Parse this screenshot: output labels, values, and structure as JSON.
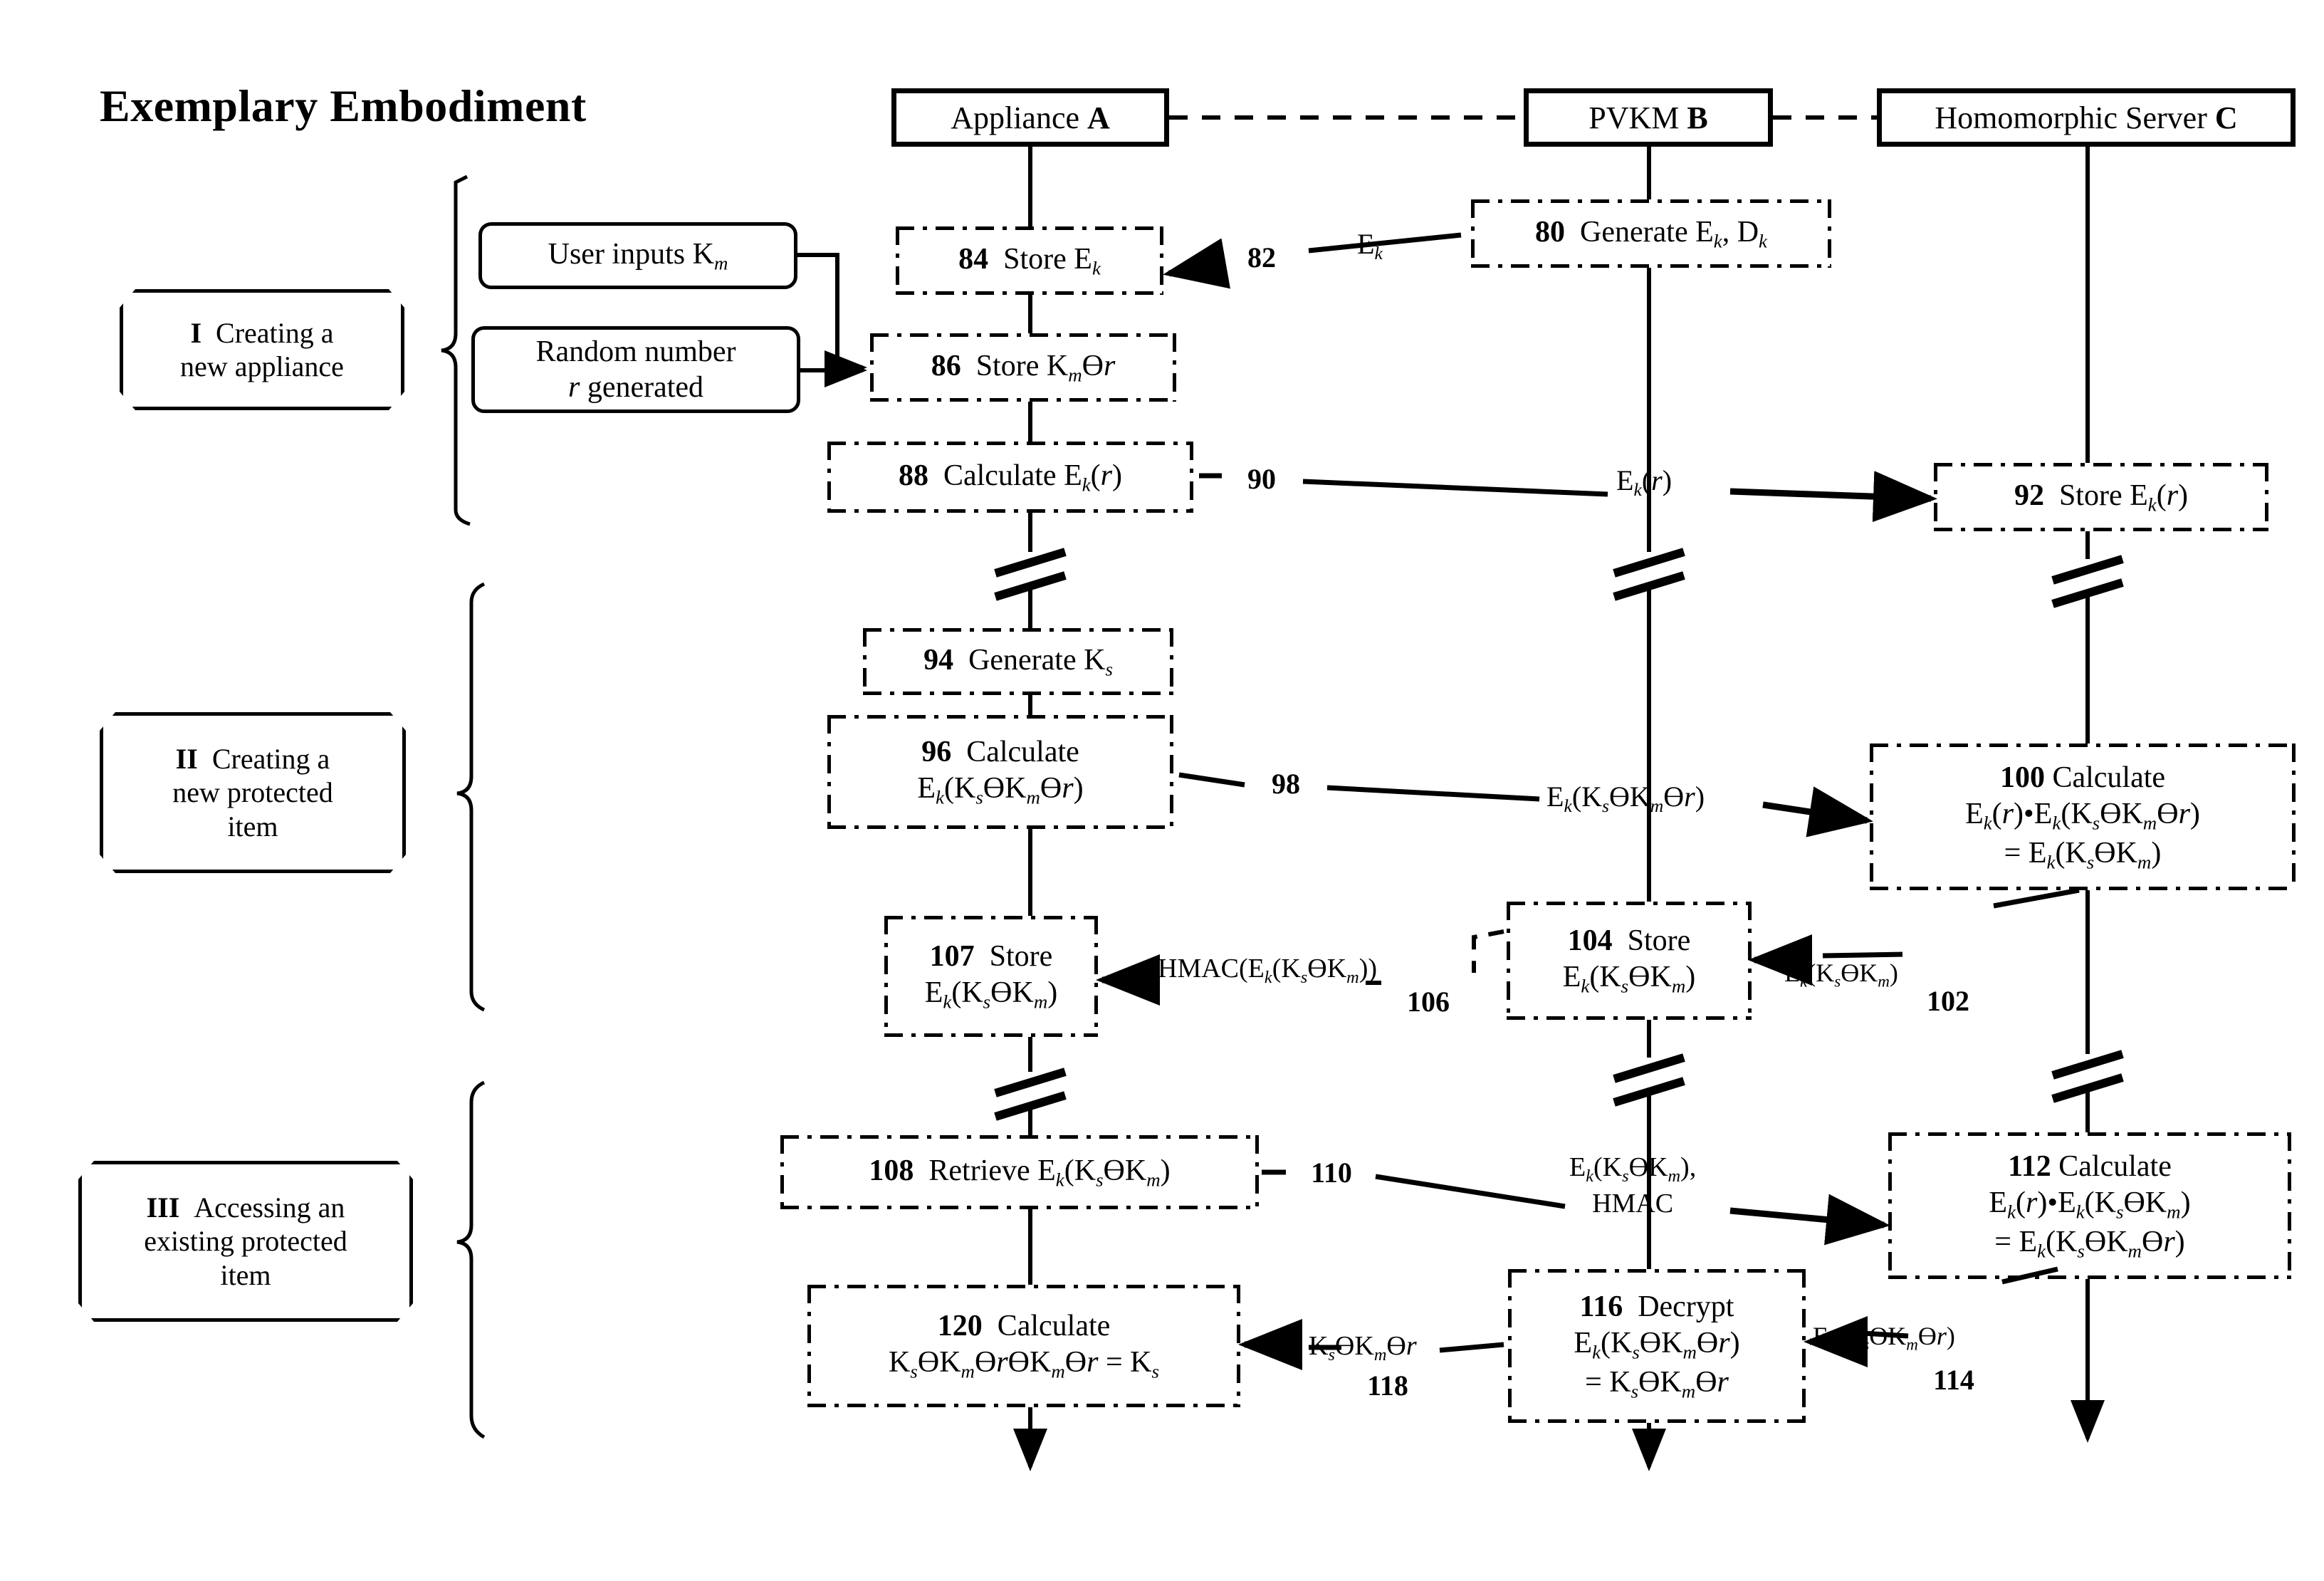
{
  "title": "Exemplary Embodiment",
  "parties": [
    {
      "id": "A",
      "name": "Appliance",
      "letter": "A"
    },
    {
      "id": "B",
      "name": "PVKM",
      "letter": "B"
    },
    {
      "id": "C",
      "name": "Homomorphic Server",
      "letter": "C"
    }
  ],
  "phases": [
    {
      "numeral": "I",
      "label": "Creating a new appliance"
    },
    {
      "numeral": "II",
      "label": "Creating a new protected item"
    },
    {
      "numeral": "III",
      "label": "Accessing an existing protected item"
    }
  ],
  "inputs": [
    {
      "id": "user-inputs",
      "text": "User inputs K_m"
    },
    {
      "id": "random-number",
      "text": "Random number r generated"
    }
  ],
  "steps": [
    {
      "num": "80",
      "column": "B",
      "text": "Generate E_k, D_k"
    },
    {
      "num": "84",
      "column": "A",
      "text": "Store E_k"
    },
    {
      "num": "86",
      "column": "A",
      "text": "Store K_mΘr"
    },
    {
      "num": "88",
      "column": "A",
      "text": "Calculate E_k(r)"
    },
    {
      "num": "92",
      "column": "C",
      "text": "Store E_k(r)"
    },
    {
      "num": "94",
      "column": "A",
      "text": "Generate K_s"
    },
    {
      "num": "96",
      "column": "A",
      "text": "Calculate E_k(K_sΘK_mΘr)"
    },
    {
      "num": "100",
      "column": "C",
      "text": "Calculate E_k(r)•E_k(K_sΘK_mΘr) = E_k(K_sΘK_m)"
    },
    {
      "num": "104",
      "column": "B",
      "text": "Store E_k(K_sΘK_m)"
    },
    {
      "num": "107",
      "column": "A",
      "text": "Store E_k(K_sΘK_m)"
    },
    {
      "num": "108",
      "column": "A",
      "text": "Retrieve E_k(K_sΘK_m)"
    },
    {
      "num": "112",
      "column": "C",
      "text": "Calculate E_k(r)•E_k(K_sΘK_m) = E_k(K_sΘK_mΘr)"
    },
    {
      "num": "116",
      "column": "B",
      "text": "Decrypt E_k(K_sΘK_mΘr) = K_sΘK_mΘr"
    },
    {
      "num": "120",
      "column": "A",
      "text": "Calculate K_sΘK_mΘrΘK_mΘr = K_s"
    }
  ],
  "tags": [
    "82",
    "90",
    "98",
    "102",
    "106",
    "110",
    "114",
    "118"
  ],
  "messages": [
    {
      "tag": "82",
      "label": "E_k",
      "from": "B",
      "to": "A"
    },
    {
      "tag": "90",
      "label": "E_k(r)",
      "from": "A",
      "to": "C"
    },
    {
      "tag": "98",
      "label": "E_k(K_sΘK_mΘr)",
      "from": "A",
      "to": "C"
    },
    {
      "tag": "102",
      "label": "E_k(K_sΘK_m)",
      "from": "C",
      "to": "B"
    },
    {
      "tag": "106",
      "label": "HMAC(E_k(K_sΘK_m))",
      "from": "B",
      "to": "A"
    },
    {
      "tag": "110",
      "label": "E_k(K_sΘK_m), HMAC",
      "from": "A",
      "to": "C"
    },
    {
      "tag": "114",
      "label": "E_k(K_sΘK_mΘr)",
      "from": "C",
      "to": "B"
    },
    {
      "tag": "118",
      "label": "K_sΘK_mΘr",
      "from": "B",
      "to": "A"
    }
  ],
  "text": {
    "title": "Exemplary Embodiment",
    "party_a": "Appliance",
    "party_a_letter": "A",
    "party_b": "PVKM",
    "party_b_letter": "B",
    "party_c": "Homomorphic Server",
    "party_c_letter": "C",
    "phase1_numeral": "I",
    "phase1_line1": "Creating a",
    "phase1_line2": "new appliance",
    "phase2_numeral": "II",
    "phase2_line1": "Creating a",
    "phase2_line2": "new protected",
    "phase2_line3": "item",
    "phase3_numeral": "III",
    "phase3_line1": "Accessing an",
    "phase3_line2": "existing protected",
    "phase3_line3": "item",
    "input1_pre": "User inputs K",
    "input1_sub": "m",
    "input2_line1": "Random number",
    "input2_line2_it": "r",
    "input2_line2_rest": " generated",
    "n80": "80",
    "n82": "82",
    "n84": "84",
    "n86": "86",
    "n88": "88",
    "n90": "90",
    "n92": "92",
    "n94": "94",
    "n96": "96",
    "n98": "98",
    "n100": "100",
    "n102": "102",
    "n104": "104",
    "n106": "106",
    "n107": "107",
    "n108": "108",
    "n110": "110",
    "n112": "112",
    "n114": "114",
    "n116": "116",
    "n118": "118",
    "n120": "120",
    "verb_generate": "Generate",
    "verb_store": "Store",
    "verb_calculate": "Calculate",
    "verb_retrieve": "Retrieve",
    "verb_decrypt": "Decrypt"
  }
}
